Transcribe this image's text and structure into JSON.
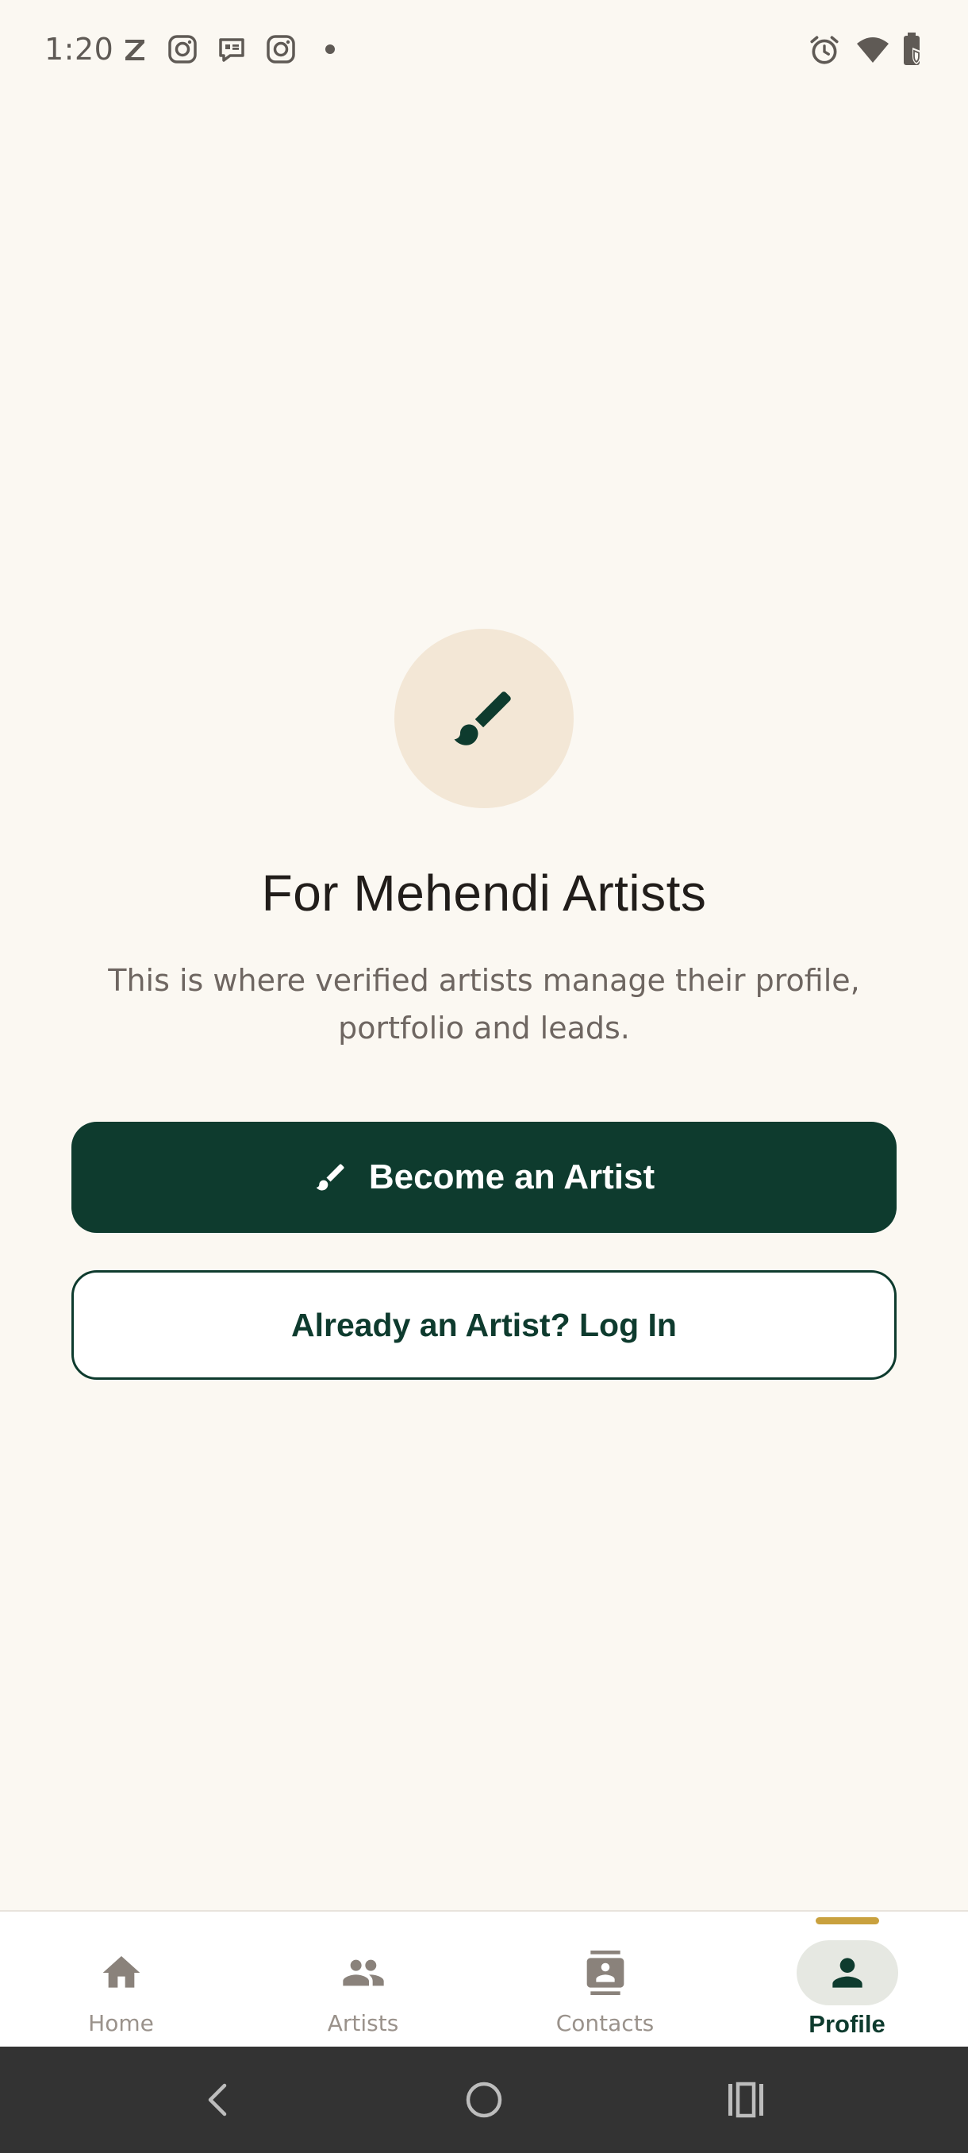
{
  "status_bar": {
    "time": "1:20",
    "left_icons": [
      "z-app-icon",
      "instagram-icon",
      "message-icon",
      "instagram-icon",
      "dot-icon"
    ],
    "right_icons": [
      "alarm-icon",
      "wifi-icon",
      "battery-icon"
    ]
  },
  "hero": {
    "icon": "paintbrush-icon",
    "title": "For Mehendi Artists",
    "subtitle": "This is where verified artists manage their profile, portfolio and leads."
  },
  "actions": {
    "primary_label": "Become an Artist",
    "primary_icon": "paintbrush-icon",
    "secondary_label": "Already an Artist? Log In"
  },
  "bottom_nav": {
    "items": [
      {
        "label": "Home",
        "icon": "home-icon",
        "active": false
      },
      {
        "label": "Artists",
        "icon": "people-icon",
        "active": false
      },
      {
        "label": "Contacts",
        "icon": "contacts-icon",
        "active": false
      },
      {
        "label": "Profile",
        "icon": "person-icon",
        "active": true
      }
    ]
  },
  "colors": {
    "background": "#FBF8F2",
    "primary": "#0E3B2E",
    "accent": "#C9A13E",
    "hero_circle": "#F3E7D6",
    "nav_inactive": "#8a827b"
  },
  "system_nav": {
    "buttons": [
      "back-icon",
      "home-circle-icon",
      "recents-icon"
    ]
  }
}
